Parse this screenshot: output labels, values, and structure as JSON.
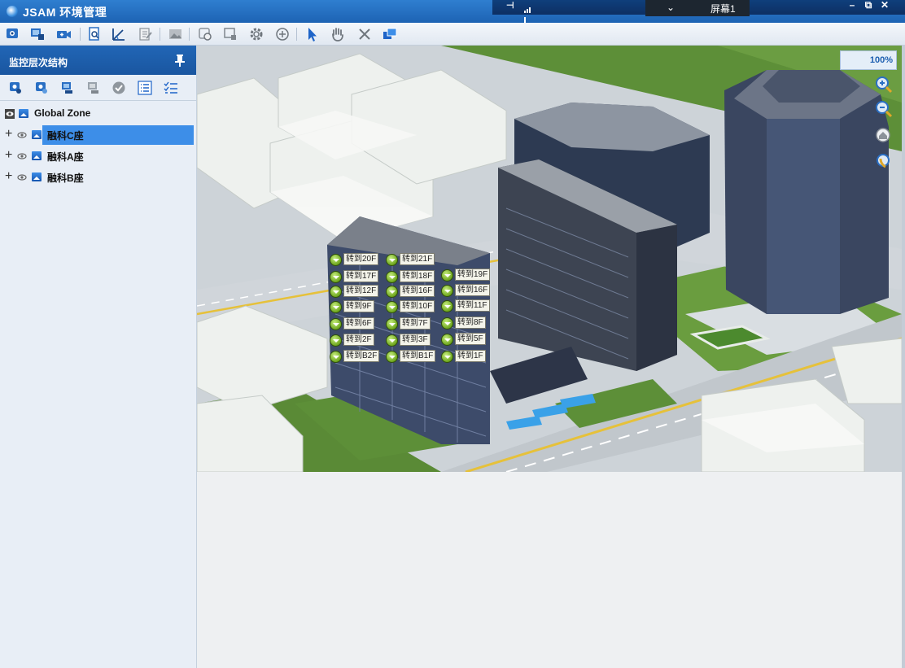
{
  "window": {
    "title": "JSAM 环境管理",
    "screen_tab_label": "屏幕1"
  },
  "left_panel": {
    "title": "监控层次结构",
    "tree": [
      {
        "label": "Global Zone",
        "expandable": false,
        "selected": false
      },
      {
        "label": "融科C座",
        "expandable": true,
        "selected": true
      },
      {
        "label": "融科A座",
        "expandable": true,
        "selected": false
      },
      {
        "label": "融科B座",
        "expandable": true,
        "selected": false
      }
    ]
  },
  "viewport": {
    "zoom_level": "100%"
  },
  "floor_buttons": [
    "转到20F",
    "转到21F",
    "转到17F",
    "转到18F",
    "转到19F",
    "转到12F",
    "转到16F",
    "转到16F",
    "转到9F",
    "转到10F",
    "转到11F",
    "转到6F",
    "转到7F",
    "转到8F",
    "转到2F",
    "转到3F",
    "转到5F",
    "转到B2F",
    "转到B1F",
    "转到1F"
  ],
  "colors": {
    "titlebar": "#1d63b3",
    "panel_header": "#1a56a0",
    "selection": "#3d8ee8",
    "grass": "#5d8f38"
  }
}
